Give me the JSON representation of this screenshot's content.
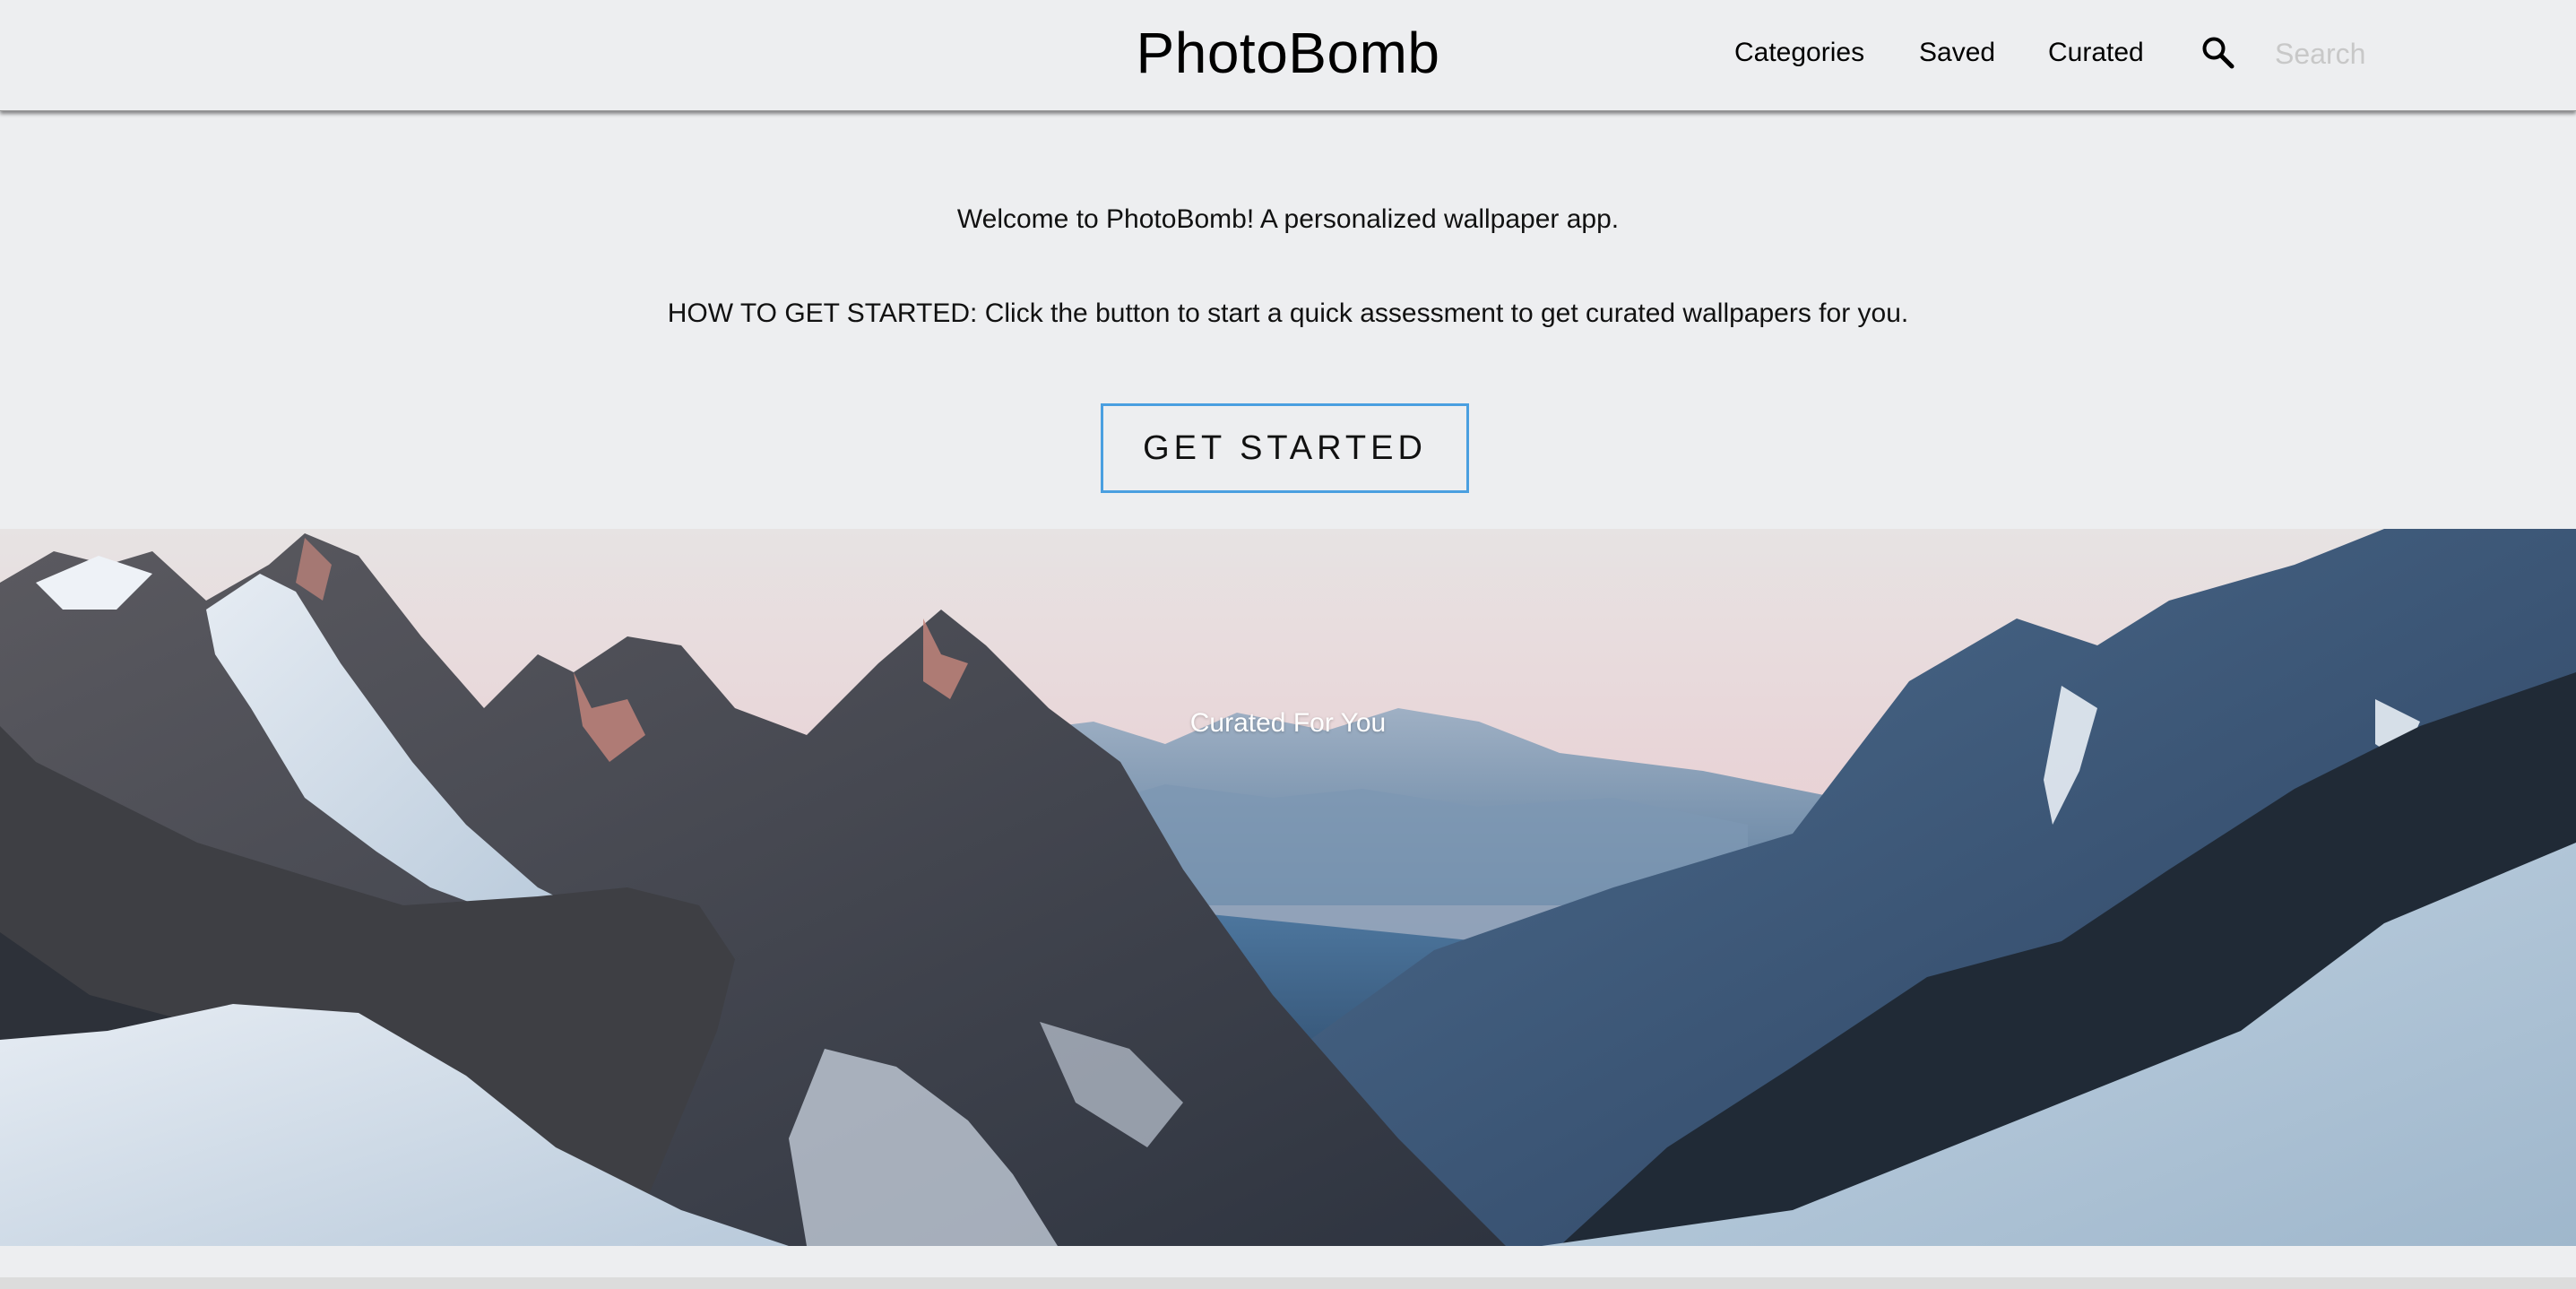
{
  "header": {
    "brand": "PhotoBomb",
    "nav": [
      "Categories",
      "Saved",
      "Curated"
    ],
    "search_placeholder": "Search",
    "search_value": "",
    "search_icon": "search-icon"
  },
  "main": {
    "welcome": "Welcome to PhotoBomb! A personalized wallpaper app.",
    "howto": "HOW TO GET STARTED: Click the button to start a quick assessment to get curated wallpapers for you.",
    "cta_label": "GET STARTED",
    "cta_border_color": "#4a9fe0"
  },
  "hero": {
    "caption": "Curated For You",
    "image": "snowy mountain range landscape"
  },
  "colors": {
    "page_background": "#edeef0",
    "text": "#111111"
  }
}
